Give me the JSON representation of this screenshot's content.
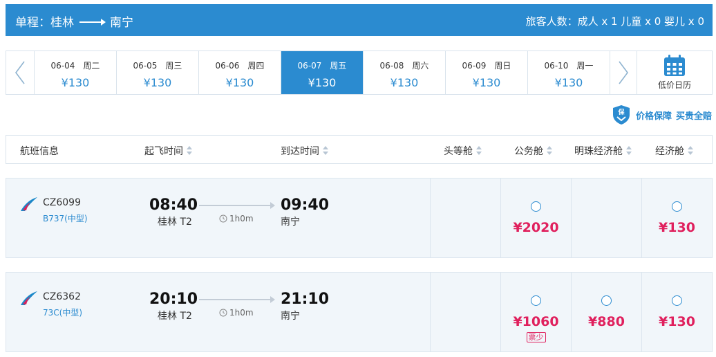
{
  "header": {
    "trip_type": "单程：",
    "origin": "桂林",
    "destination": "南宁",
    "passengers": "旅客人数：成人 x 1 儿童 x 0 婴儿 x 0"
  },
  "dates": [
    {
      "date": "06-04",
      "weekday": "周二",
      "price": "¥130",
      "active": false
    },
    {
      "date": "06-05",
      "weekday": "周三",
      "price": "¥130",
      "active": false
    },
    {
      "date": "06-06",
      "weekday": "周四",
      "price": "¥130",
      "active": false
    },
    {
      "date": "06-07",
      "weekday": "周五",
      "price": "¥130",
      "active": true
    },
    {
      "date": "06-08",
      "weekday": "周六",
      "price": "¥130",
      "active": false
    },
    {
      "date": "06-09",
      "weekday": "周日",
      "price": "¥130",
      "active": false
    },
    {
      "date": "06-10",
      "weekday": "周一",
      "price": "¥130",
      "active": false
    }
  ],
  "calendar_label": "低价日历",
  "guarantee": {
    "badge": "保",
    "text1": "价格保障",
    "text2": "买贵全赔"
  },
  "columns": {
    "flight": "航班信息",
    "depart": "起飞时间",
    "arrive": "到达时间",
    "first": "头等舱",
    "business": "公务舱",
    "pearl": "明珠经济舱",
    "economy": "经济舱"
  },
  "flights": [
    {
      "flight_no": "CZ6099",
      "aircraft": "B737(中型)",
      "dep_time": "08:40",
      "dep_airport": "桂林 T2",
      "duration": "1h0m",
      "arr_time": "09:40",
      "arr_airport": "南宁",
      "business_price": "¥2020",
      "pearl_price": "",
      "economy_price": "¥130",
      "business_tag": ""
    },
    {
      "flight_no": "CZ6362",
      "aircraft": "73C(中型)",
      "dep_time": "20:10",
      "dep_airport": "桂林 T2",
      "duration": "1h0m",
      "arr_time": "21:10",
      "arr_airport": "南宁",
      "business_price": "¥1060",
      "pearl_price": "¥880",
      "economy_price": "¥130",
      "business_tag": "票少"
    }
  ],
  "colors": {
    "brand_blue": "#2b8bd0",
    "price_red": "#e0205d",
    "row_bg": "#f1f6fa"
  },
  "icons": [
    "chevron-left-icon",
    "chevron-right-icon",
    "calendar-icon",
    "shield-icon",
    "airline-logo-icon",
    "clock-icon"
  ]
}
